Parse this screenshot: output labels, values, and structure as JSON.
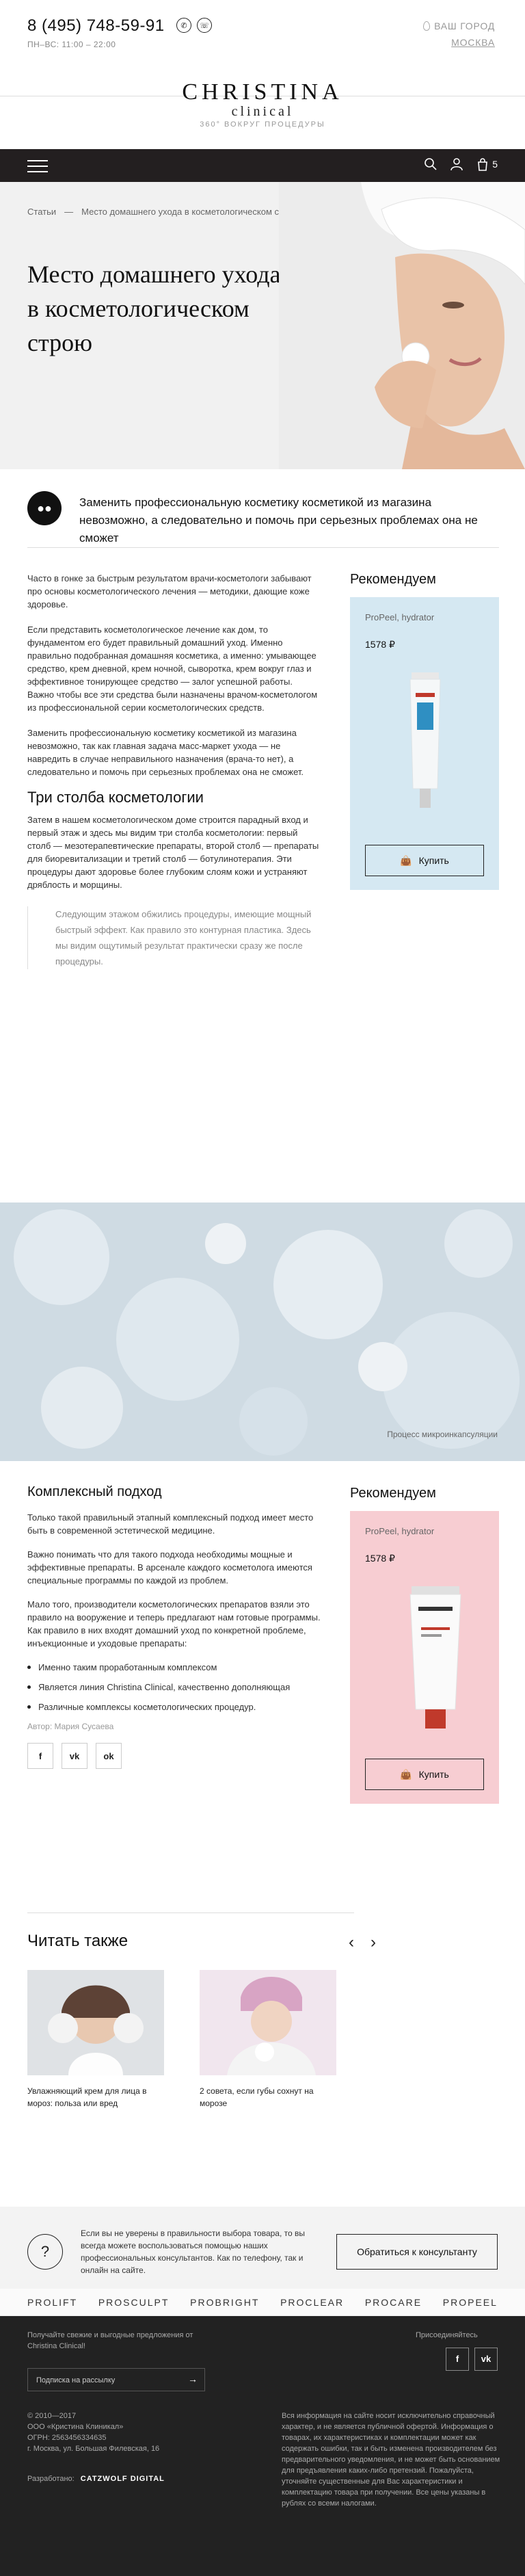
{
  "header": {
    "phone": "8 (495) 748-59-91",
    "hours": "ПН–ВС: 11:00 – 22:00",
    "city_label": "ВАШ ГОРОД",
    "city_name": "МОСКВА",
    "logo_main": "CHRISTINA",
    "logo_sub": "clinical",
    "logo_tag": "360° ВОКРУГ ПРОЦЕДУРЫ",
    "cart_count": "5"
  },
  "hero": {
    "breadcrumb_1": "Статьи",
    "breadcrumb_2": "Место домашнего ухода в косметологическом строю",
    "title": "Место домашнего ухода в косметологическом строю"
  },
  "intro": {
    "text": "Заменить профессиональную косметику косметикой из магазина невозможно, а следовательно и помочь при серьезных проблемах она не сможет"
  },
  "article": {
    "p1": "Часто в гонке за быстрым результатом врачи-косметологи забывают про основы косметологического лечения — методики, дающие коже здоровье.",
    "p2": "Если представить косметологическое лечение как дом, то фундаментом его будет правильный домашний уход. Именно правильно подобранная домашняя косметика, а именно: умывающее средство, крем дневной, крем ночной, сыворотка, крем вокруг глаз и эффективное тонирующее средство — залог успешной работы. Важно чтобы все эти средства были назначены врачом-косметологом из профессиональной серии косметологических средств.",
    "p3": "Заменить профессиональную косметику косметикой из магазина невозможно, так как главная задача масс-маркет ухода — не навредить в случае неправильного назначения (врача-то нет), а следовательно и помочь при серьезных проблемах она не сможет.",
    "h2": "Три столба косметологии",
    "p4": "Затем в нашем косметологическом доме строится парадный вход и первый этаж и здесь мы видим три столба косметологии: первый столб — мезотерапевтические препараты, второй столб — препараты для биоревитализации и третий столб — ботулинотерапия. Эти процедуры дают здоровье более глубоким слоям кожи и устраняют дряблость и морщины.",
    "quote": "Следующим этажом обжились процедуры, имеющие мощный быстрый эффект. Как правило это контурная пластика. Здесь мы видим ощутимый результат практически сразу же после процедуры."
  },
  "rec1": {
    "title": "Рекомендуем",
    "product": "ProPeel, hydrator",
    "price": "1578 ₽",
    "buy": "Купить",
    "color": "#d5e8f2"
  },
  "photo": {
    "caption": "Процесс микроинкапсуляции"
  },
  "section2": {
    "h2": "Комплексный подход",
    "p1": "Только такой правильный этапный комплексный подход имеет место быть в современной эстетической медицине.",
    "p2": "Важно понимать что для такого подхода необходимы мощные и эффективные препараты. В арсенале каждого косметолога имеются специальные программы по каждой из проблем.",
    "p3": "Мало того, производители косметологических препаратов взяли это правило на вооружение и теперь предлагают нам готовые программы. Как правило в них входят домашний уход по конкретной проблеме, инъекционные и уходовые препараты:",
    "list": [
      "Именно таким проработанным комплексом",
      "Является линия Christina Clinical, качественно дополняющая",
      "Различные комплексы косметологических процедур."
    ],
    "author": "Автор: Мария Сусаева"
  },
  "rec2": {
    "title": "Рекомендуем",
    "product": "ProPeel, hydrator",
    "price": "1578 ₽",
    "buy": "Купить",
    "color": "#f7cdd2"
  },
  "read_also": {
    "title": "Читать также",
    "cards": [
      {
        "caption": "Увлажняющий крем для лица в мороз: польза или вред"
      },
      {
        "caption": "2 совета, если губы сохнут на морозе"
      }
    ]
  },
  "consult": {
    "text": "Если вы не уверены в правильности выбора товара, то вы всегда можете воспользоваться помощью наших профессиональных консультантов. Как по телефону, так и онлайн на сайте.",
    "button": "Обратиться к консультанту"
  },
  "lines": [
    "PROLIFT",
    "PROSCULPT",
    "PROBRIGHT",
    "PROCLEAR",
    "PROCARE",
    "PROPEEL"
  ],
  "footer": {
    "subscribe_text": "Получайте свежие и выгодные предложения от Christina Clinical!",
    "subscribe_placeholder": "Подписка на рассылку",
    "join": "Присоединяйтесь",
    "copyright": "© 2010—2017\nООО «Кристина Клиникал»\nОГРН: 2563456334635\nг. Москва, ул. Большая Филевская, 16",
    "legal": "Вся информация на сайте носит исключительно справочный характер, и не является публичной офертой. Информация о товарах, их характеристиках и комплектации может как содержать ошибки, так и быть изменена производителем без предварительного уведомления, и не может быть основанием для предъявления каких-либо претензий. Пожалуйста, уточняйте существенные для Вас характеристики и комплектацию товара при получении. Все цены указаны в рублях со всеми налогами.",
    "dev_label": "Разработано:",
    "dev_name": "CATZWOLF DIGITAL"
  }
}
